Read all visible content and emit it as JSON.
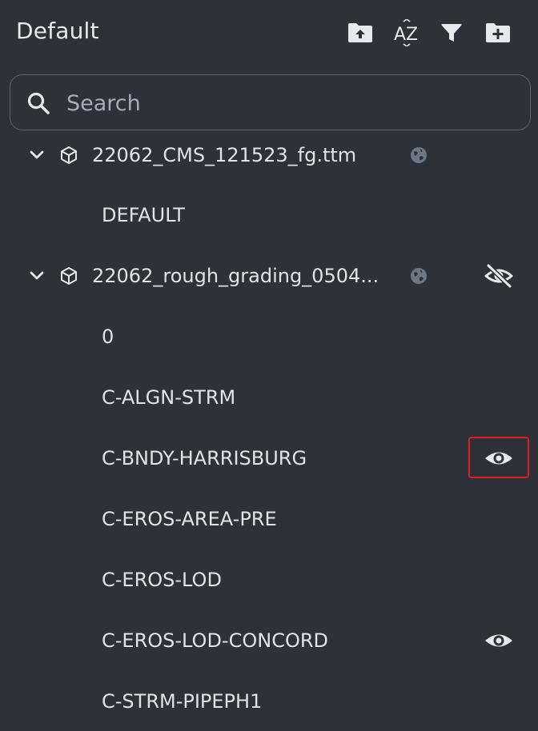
{
  "header": {
    "title": "Default",
    "toolbar": [
      {
        "name": "upload-folder-icon"
      },
      {
        "name": "sort-az-icon"
      },
      {
        "name": "filter-icon"
      },
      {
        "name": "add-folder-icon"
      }
    ]
  },
  "search": {
    "placeholder": "Search",
    "value": ""
  },
  "tree": {
    "files": [
      {
        "name": "22062_CMS_121523_fg.ttm",
        "expanded": true,
        "icons": [
          "chevron-down-icon",
          "cube-icon",
          "globe-icon"
        ],
        "layers": [
          {
            "name": "DEFAULT"
          }
        ]
      },
      {
        "name": "22062_rough_grading_0504...",
        "expanded": true,
        "visibility": "hidden",
        "icons": [
          "chevron-down-icon",
          "cube-icon",
          "globe-icon",
          "eye-off-icon"
        ],
        "layers": [
          {
            "name": "0"
          },
          {
            "name": "C-ALGN-STRM"
          },
          {
            "name": "C-BNDY-HARRISBURG",
            "visibility": "visible",
            "highlighted": true
          },
          {
            "name": "C-EROS-AREA-PRE"
          },
          {
            "name": "C-EROS-LOD"
          },
          {
            "name": "C-EROS-LOD-CONCORD",
            "visibility": "visible"
          },
          {
            "name": "C-STRM-PIPEPH1"
          }
        ]
      }
    ]
  },
  "colors": {
    "background": "#2c313a",
    "text": "#dfe3ea",
    "muted_icon": "#6d7683",
    "icon": "#e6e9ee",
    "highlight_border": "#e02020"
  }
}
